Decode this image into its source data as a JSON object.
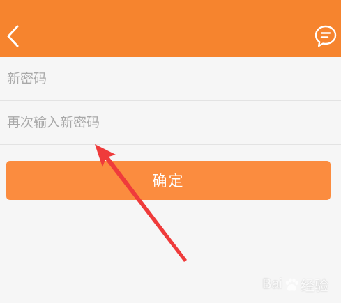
{
  "header": {
    "back_icon": "chevron-left-icon",
    "message_icon": "chat-bubble-icon",
    "background_color": "#f6842e"
  },
  "form": {
    "new_password_placeholder": "新密码",
    "confirm_password_placeholder": "再次输入新密码"
  },
  "actions": {
    "confirm_label": "确定",
    "button_color": "#fb8c3f"
  },
  "annotation": {
    "arrow_color": "#ef3b3b"
  },
  "watermark": {
    "brand_left": "Bai",
    "brand_right": "经验"
  }
}
